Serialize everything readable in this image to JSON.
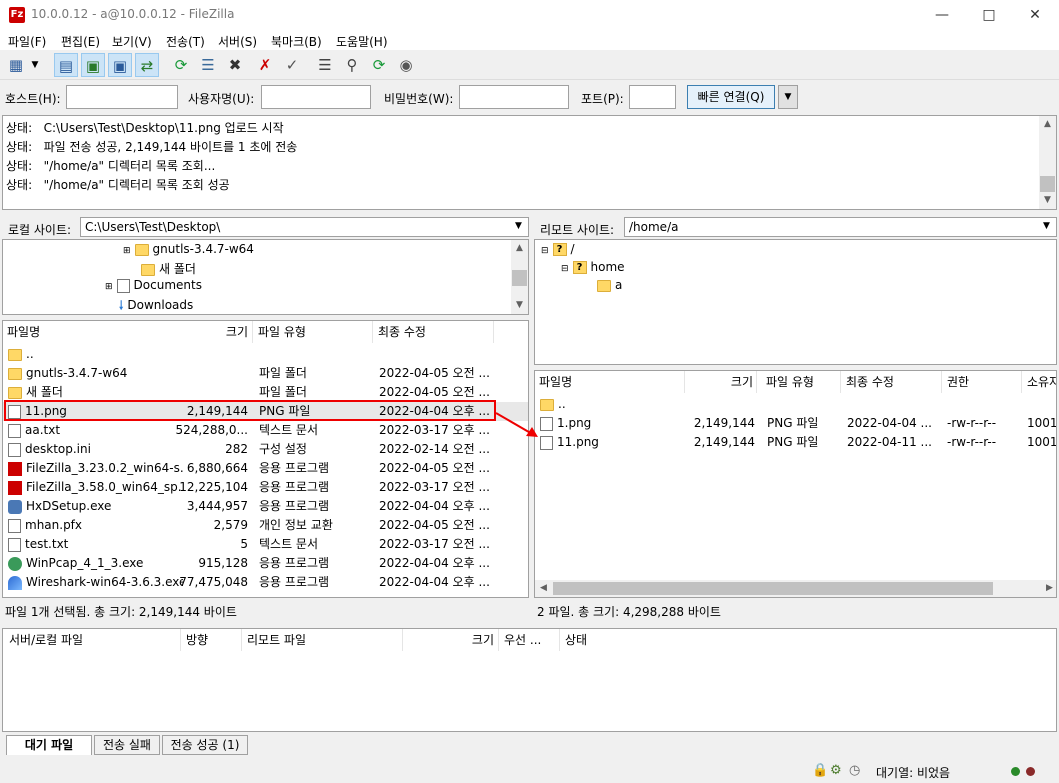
{
  "window": {
    "title": "10.0.0.12 - a@10.0.0.12 - FileZilla",
    "app_icon": "Fz"
  },
  "menu": [
    "파일(F)",
    "편집(E)",
    "보기(V)",
    "전송(T)",
    "서버(S)",
    "북마크(B)",
    "도움말(H)"
  ],
  "quickconnect": {
    "host_label": "호스트(H):",
    "user_label": "사용자명(U):",
    "pass_label": "비밀번호(W):",
    "port_label": "포트(P):",
    "connect_label": "빠른 연결(Q)",
    "host_value": "",
    "user_value": "",
    "pass_value": "",
    "port_value": ""
  },
  "log": [
    "상태:   C:\\Users\\Test\\Desktop\\11.png 업로드 시작",
    "상태:   파일 전송 성공, 2,149,144 바이트를 1 초에 전송",
    "상태:   \"/home/a\" 디렉터리 목록 조회...",
    "상태:   \"/home/a\" 디렉터리 목록 조회 성공"
  ],
  "local": {
    "site_label": "로컬 사이트:",
    "site_path": "C:\\Users\\Test\\Desktop\\",
    "tree": [
      "gnutls-3.4.7-w64",
      "새 폴더",
      "Documents",
      "Downloads"
    ],
    "headers": {
      "name": "파일명",
      "size": "크기",
      "type": "파일 유형",
      "modified": "최종 수정"
    },
    "files": [
      {
        "name": "..",
        "size": "",
        "type": "",
        "modified": ""
      },
      {
        "name": "gnutls-3.4.7-w64",
        "size": "",
        "type": "파일 폴더",
        "modified": "2022-04-05 오전 ..."
      },
      {
        "name": "새 폴더",
        "size": "",
        "type": "파일 폴더",
        "modified": "2022-04-05 오전 ..."
      },
      {
        "name": "11.png",
        "size": "2,149,144",
        "type": "PNG 파일",
        "modified": "2022-04-04 오후 ..."
      },
      {
        "name": "aa.txt",
        "size": "524,288,0...",
        "type": "텍스트 문서",
        "modified": "2022-03-17 오후 ..."
      },
      {
        "name": "desktop.ini",
        "size": "282",
        "type": "구성 설정",
        "modified": "2022-02-14 오전 ..."
      },
      {
        "name": "FileZilla_3.23.0.2_win64-s...",
        "size": "6,880,664",
        "type": "응용 프로그램",
        "modified": "2022-04-05 오전 ..."
      },
      {
        "name": "FileZilla_3.58.0_win64_sp...",
        "size": "12,225,104",
        "type": "응용 프로그램",
        "modified": "2022-03-17 오전 ..."
      },
      {
        "name": "HxDSetup.exe",
        "size": "3,444,957",
        "type": "응용 프로그램",
        "modified": "2022-04-04 오후 ..."
      },
      {
        "name": "mhan.pfx",
        "size": "2,579",
        "type": "개인 정보 교환",
        "modified": "2022-04-05 오전 ..."
      },
      {
        "name": "test.txt",
        "size": "5",
        "type": "텍스트 문서",
        "modified": "2022-03-17 오전 ..."
      },
      {
        "name": "WinPcap_4_1_3.exe",
        "size": "915,128",
        "type": "응용 프로그램",
        "modified": "2022-04-04 오후 ..."
      },
      {
        "name": "Wireshark-win64-3.6.3.exe",
        "size": "77,475,048",
        "type": "응용 프로그램",
        "modified": "2022-04-04 오후 ..."
      }
    ],
    "status": "파일 1개 선택됨. 총 크기: 2,149,144 바이트"
  },
  "remote": {
    "site_label": "리모트 사이트:",
    "site_path": "/home/a",
    "tree": [
      "/",
      "home",
      "a"
    ],
    "headers": {
      "name": "파일명",
      "size": "크기",
      "type": "파일 유형",
      "modified": "최종 수정",
      "perm": "권한",
      "owner": "소유자"
    },
    "files": [
      {
        "name": "..",
        "size": "",
        "type": "",
        "modified": "",
        "perm": "",
        "owner": ""
      },
      {
        "name": "1.png",
        "size": "2,149,144",
        "type": "PNG 파일",
        "modified": "2022-04-04 ...",
        "perm": "-rw-r--r--",
        "owner": "1001"
      },
      {
        "name": "11.png",
        "size": "2,149,144",
        "type": "PNG 파일",
        "modified": "2022-04-11 ...",
        "perm": "-rw-r--r--",
        "owner": "1001"
      }
    ],
    "status": "2 파일. 총 크기: 4,298,288 바이트"
  },
  "queue": {
    "headers": [
      "서버/로컬 파일",
      "방향",
      "리모트 파일",
      "크기",
      "우선 ...",
      "상태"
    ],
    "tabs": [
      "대기 파일",
      "전송 실패",
      "전송 성공 (1)"
    ]
  },
  "statusbar": {
    "queue_text": "대기열: 비었음"
  }
}
